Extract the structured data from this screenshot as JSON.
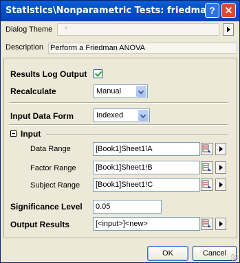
{
  "window": {
    "title": "Statistics\\Nonparametric Tests: friedman"
  },
  "titlebar": {
    "help_glyph": "?",
    "close_glyph": "✕"
  },
  "theme": {
    "label": "Dialog Theme",
    "value": "*"
  },
  "description": {
    "label": "Description",
    "value": "Perform a Friedman ANOVA"
  },
  "results_log": {
    "label": "Results Log Output",
    "checked": true
  },
  "recalculate": {
    "label": "Recalculate",
    "value": "Manual"
  },
  "input_form": {
    "label": "Input Data Form",
    "value": "Indexed"
  },
  "input_group": {
    "label": "Input"
  },
  "data_range": {
    "label": "Data Range",
    "value": "[Book1]Sheet1!A"
  },
  "factor_range": {
    "label": "Factor Range",
    "value": "[Book1]Sheet1!B"
  },
  "subject_range": {
    "label": "Subject Range",
    "value": "[Book1]Sheet1!C"
  },
  "significance": {
    "label": "Significance Level",
    "value": "0.05"
  },
  "output": {
    "label": "Output Results",
    "value": "[<input>]<new>"
  },
  "buttons": {
    "ok": "OK",
    "cancel": "Cancel"
  }
}
